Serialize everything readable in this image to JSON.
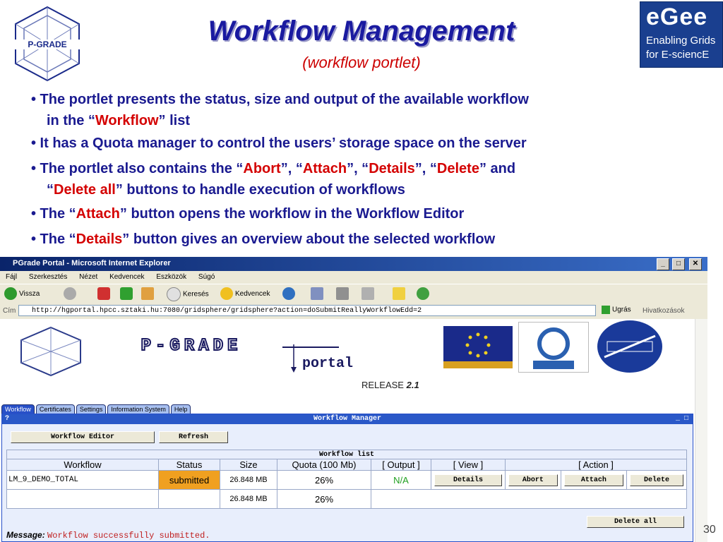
{
  "slide": {
    "title": "Workflow Management",
    "subtitle": "(workflow portlet)",
    "pgrade_logo_text": "P-GRADE",
    "egee_logo": {
      "word": "eGee",
      "line1": "Enabling Grids",
      "line2": "for E-sciencE"
    },
    "bullets": [
      {
        "pre": "• The portlet presents the status, size and output of the available workflow"
      },
      {
        "pre": "in the “",
        "hl1": "Workflow",
        "post": "” list"
      },
      {
        "pre": "• It has a Quota manager to control the users’ storage space on the server"
      },
      {
        "pre": "• The portlet also contains the “",
        "hl1": "Abort",
        "mid1": "”, “",
        "hl2": "Attach",
        "mid2": "”, “",
        "hl3": "Details",
        "mid3": "”, “",
        "hl4": "Delete",
        "post": "” and"
      },
      {
        "pre": "“",
        "hl1": "Delete all",
        "post": "” buttons to handle execution of workflows"
      },
      {
        "pre": "• The “",
        "hl1": "Attach",
        "post": "” button opens the workflow in the Workflow Editor"
      },
      {
        "pre": "• The “",
        "hl1": "Details",
        "post": "” button gives an overview about the selected workflow"
      }
    ],
    "page_number": "30"
  },
  "browser": {
    "title": "PGrade Portal - Microsoft Internet Explorer",
    "menu": [
      "Fájl",
      "Szerkesztés",
      "Nézet",
      "Kedvencek",
      "Eszközök",
      "Súgó"
    ],
    "toolbar": {
      "back": "Vissza",
      "search": "Keresés",
      "favorites": "Kedvencek"
    },
    "address_label": "Cím",
    "address": "http://hgportal.hpcc.sztaki.hu:7080/gridsphere/gridsphere?action=doSubmitReallyWorkflowEdd=2",
    "go": "Ugrás",
    "links": "Hivatkozások"
  },
  "portal": {
    "banner_word": "P-GRADE",
    "portal_word": "portal",
    "release_label": "RELEASE",
    "release_version": "2.1",
    "tabs": [
      "Workflow",
      "Certificates",
      "Settings",
      "Information System",
      "Help"
    ],
    "manager": {
      "title": "Workflow Manager",
      "help_mark": "?",
      "editor_button": "Workflow Editor",
      "refresh_button": "Refresh",
      "list_caption": "Workflow list",
      "headers": [
        "Workflow",
        "Status",
        "Size",
        "Quota (100 Mb)",
        "[ Output ]",
        "[ View ]",
        "[ Action ]"
      ],
      "rows": [
        {
          "name": "LM_9_DEMO_TOTAL",
          "status": "submitted",
          "size": "26.848 MB",
          "quota": "26%",
          "output": "N/A",
          "details": "Details",
          "abort": "Abort",
          "attach": "Attach",
          "delete": "Delete"
        },
        {
          "name": "",
          "status": "",
          "size": "26.848 MB",
          "quota": "26%"
        }
      ],
      "delete_all": "Delete all",
      "message_label": "Message:",
      "message": "Workflow successfully submitted."
    }
  },
  "colors": {
    "title": "#1a1aa0",
    "highlight": "#d40000",
    "ie_title": "#0a246a",
    "status_bg": "#f0a020"
  }
}
